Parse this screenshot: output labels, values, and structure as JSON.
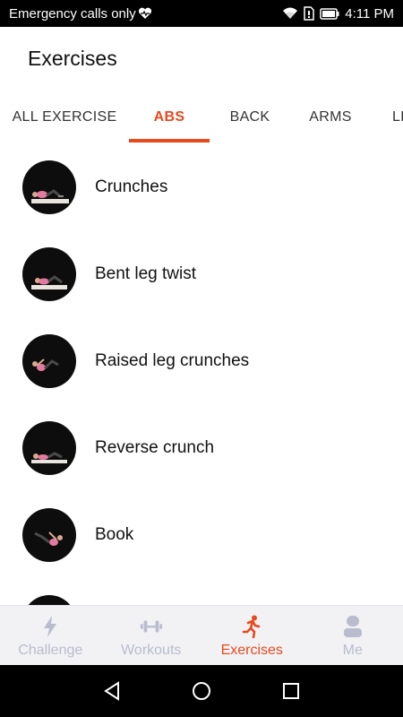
{
  "status_bar": {
    "carrier_text": "Emergency calls only",
    "time": "4:11 PM",
    "icons": [
      "heart-monitor-icon",
      "wifi-icon",
      "sim-icon",
      "battery-icon"
    ]
  },
  "header": {
    "title": "Exercises"
  },
  "tabs": [
    {
      "label": "ALL EXERCISE",
      "active": false
    },
    {
      "label": "ABS",
      "active": true
    },
    {
      "label": "BACK",
      "active": false
    },
    {
      "label": "ARMS",
      "active": false
    },
    {
      "label": "LE",
      "active": false
    }
  ],
  "exercises": [
    {
      "name": "Crunches",
      "icon": "crunches-thumbnail"
    },
    {
      "name": "Bent leg twist",
      "icon": "bent-leg-twist-thumbnail"
    },
    {
      "name": "Raised leg crunches",
      "icon": "raised-leg-crunches-thumbnail"
    },
    {
      "name": "Reverse crunch",
      "icon": "reverse-crunch-thumbnail"
    },
    {
      "name": "Book",
      "icon": "book-thumbnail"
    },
    {
      "name": "",
      "icon": "next-exercise-thumbnail"
    }
  ],
  "bottom_nav": [
    {
      "label": "Challenge",
      "icon": "lightning-icon",
      "active": false
    },
    {
      "label": "Workouts",
      "icon": "dumbbell-icon",
      "active": false
    },
    {
      "label": "Exercises",
      "icon": "running-person-icon",
      "active": true
    },
    {
      "label": "Me",
      "icon": "person-icon",
      "active": false
    }
  ],
  "colors": {
    "accent": "#e8491d",
    "inactive_nav": "#b8bccd",
    "nav_background": "#f2f2f5"
  }
}
